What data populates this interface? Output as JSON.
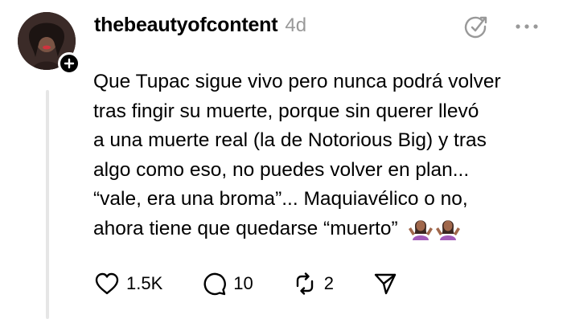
{
  "post": {
    "username": "thebeautyofcontent",
    "time": "4d",
    "text_lines": [
      "Que Tupac sigue vivo pero nunca podrá volver",
      "tras fingir su muerte, porque sin querer llevó",
      "a una muerte real (la de Notorious Big) y tras",
      "algo como eso, no puedes volver en plan...",
      "“vale, era una broma”... Maquiavélico o no,",
      "ahora tiene que quedarse “muerto”"
    ],
    "emojis": [
      "🤷🏾‍♀️",
      "🤷🏾‍♀️"
    ]
  },
  "actions": {
    "likes": "1.5K",
    "replies": "10",
    "reposts": "2"
  },
  "icons": {
    "follow": "plus-icon",
    "translate": "translate-icon",
    "more": "more-icon",
    "like": "heart-icon",
    "reply": "comment-icon",
    "repost": "repost-icon",
    "share": "send-icon"
  },
  "colors": {
    "text": "#000000",
    "muted": "#999999",
    "thread_line": "#e6e6e6"
  }
}
